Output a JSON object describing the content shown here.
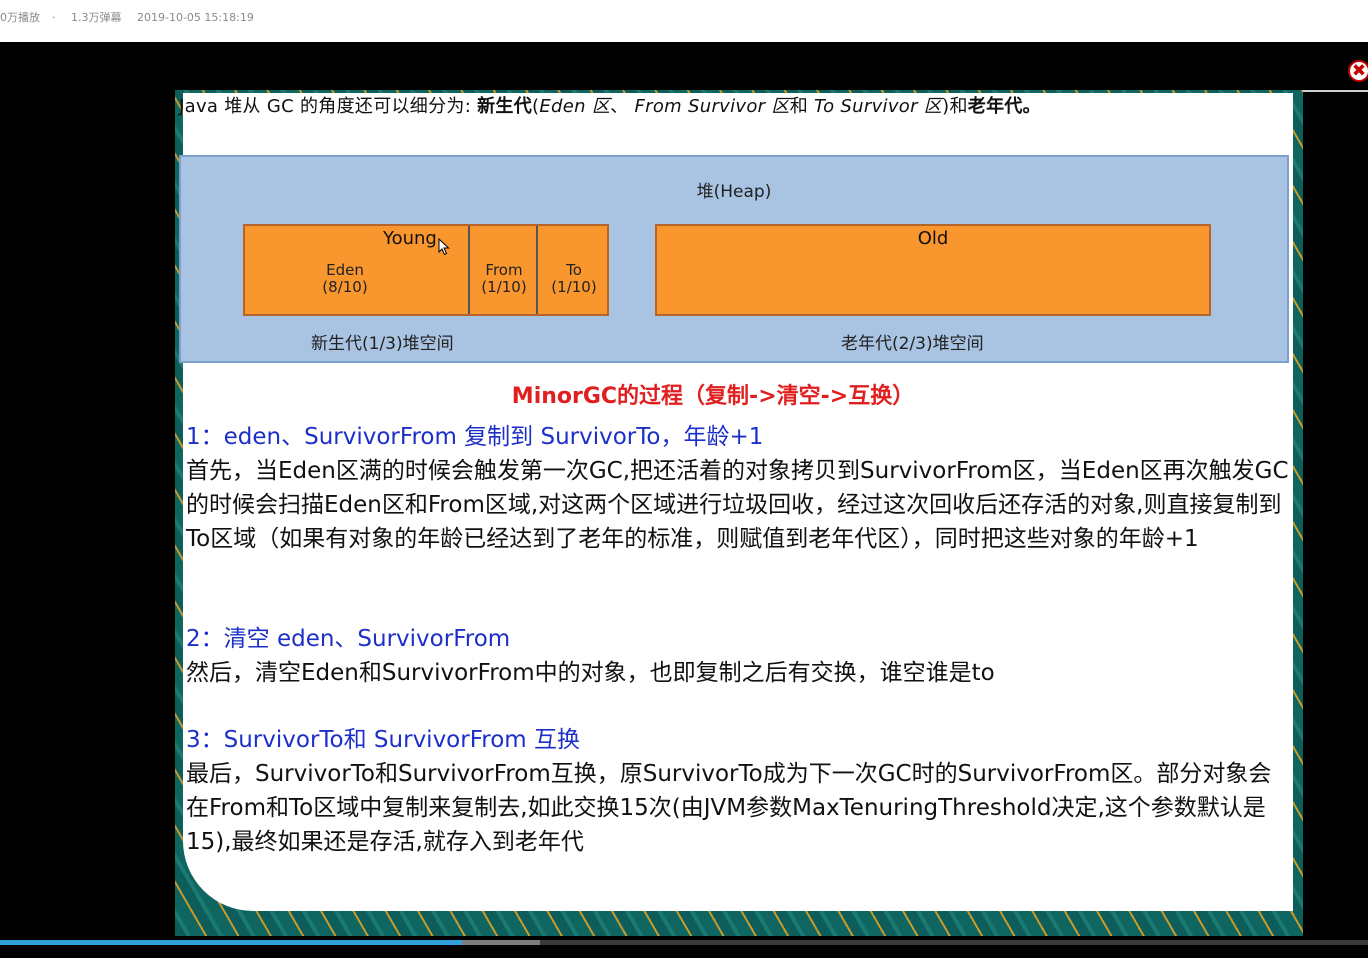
{
  "video_meta": {
    "plays": "0万播放",
    "danmaku": "1.3万弹幕",
    "timestamp": "2019-10-05 15:18:19"
  },
  "close_icon": "✖",
  "progress": {
    "played_fraction": 0.338,
    "buffered_fraction": 0.395
  },
  "slide": {
    "intro": {
      "prefix": "Java 堆从 GC 的角度还可以细分为: ",
      "young_gen": "新生代",
      "eden": "Eden 区",
      "sep": "、",
      "from": "From Survivor 区",
      "and": "和",
      "to": "To Survivor 区",
      "close": ")",
      "and2": "和",
      "old_gen": "老年代",
      "end": "。"
    },
    "heap_diagram": {
      "heap_label": "堆(Heap)",
      "young_label": "Young",
      "eden_name": "Eden",
      "eden_ratio": "(8/10)",
      "from_name": "From",
      "from_ratio": "(1/10)",
      "to_name": "To",
      "to_ratio": "(1/10)",
      "old_label": "Old",
      "young_space_label": "新生代(1/3)堆空间",
      "old_space_label": "老年代(2/3)堆空间"
    },
    "section_title": "MinorGC的过程（复制->清空->互换）",
    "steps": [
      {
        "heading": "1：eden、SurvivorFrom 复制到 SurvivorTo，年龄+1",
        "body": "首先，当Eden区满的时候会触发第一次GC,把还活着的对象拷贝到SurvivorFrom区，当Eden区再次触发GC的时候会扫描Eden区和From区域,对这两个区域进行垃圾回收，经过这次回收后还存活的对象,则直接复制到To区域（如果有对象的年龄已经达到了老年的标准，则赋值到老年代区），同时把这些对象的年龄+1"
      },
      {
        "heading": "2：清空 eden、SurvivorFrom",
        "body": "然后，清空Eden和SurvivorFrom中的对象，也即复制之后有交换，谁空谁是to"
      },
      {
        "heading": "3：SurvivorTo和 SurvivorFrom 互换",
        "body": "最后，SurvivorTo和SurvivorFrom互换，原SurvivorTo成为下一次GC时的SurvivorFrom区。部分对象会在From和To区域中复制来复制去,如此交换15次(由JVM参数MaxTenuringThreshold决定,这个参数默认是15),最终如果还是存活,就存入到老年代"
      }
    ]
  }
}
